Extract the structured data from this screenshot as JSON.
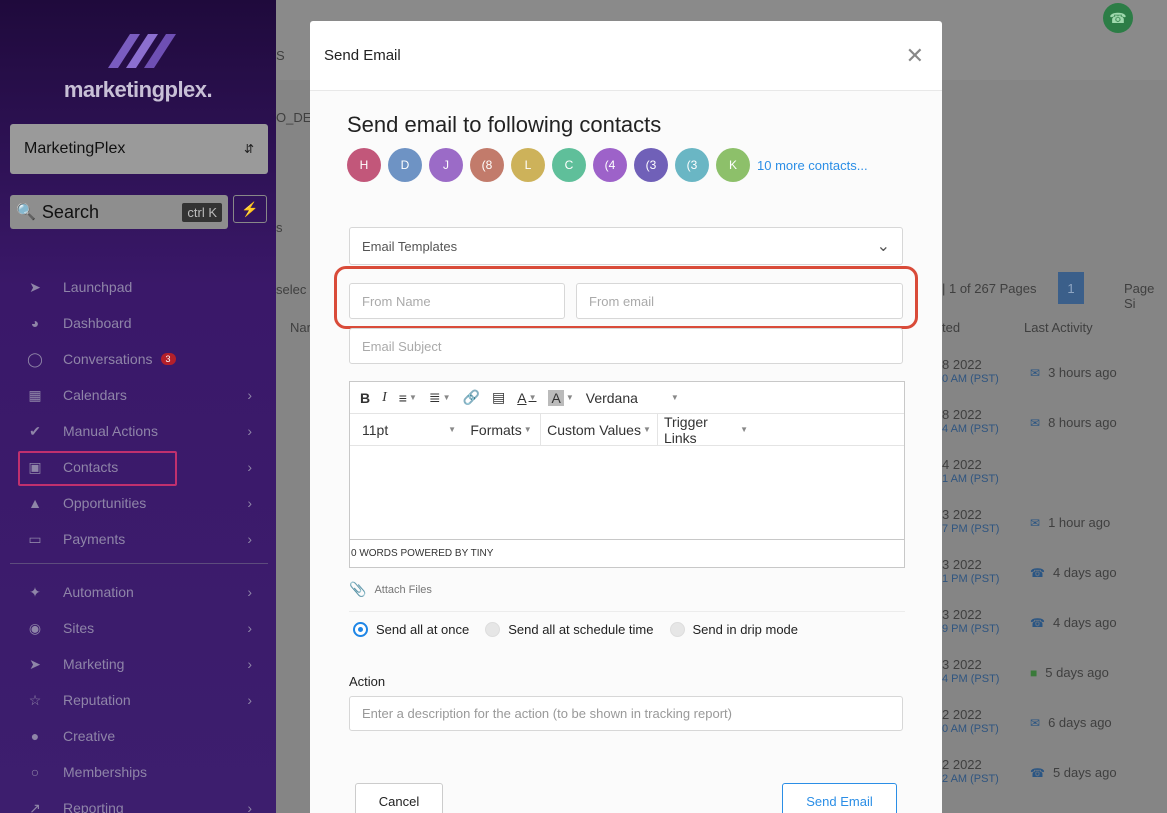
{
  "sidebar": {
    "logo": "marketingplex.",
    "account": "MarketingPlex",
    "search_label": "Search",
    "search_shortcut": "ctrl K",
    "nav_group_1": [
      {
        "label": "Launchpad",
        "icon": "rocket-icon"
      },
      {
        "label": "Dashboard",
        "icon": "speedometer-icon"
      },
      {
        "label": "Conversations",
        "icon": "chat-icon",
        "badge": "3"
      },
      {
        "label": "Calendars",
        "icon": "calendar-icon"
      },
      {
        "label": "Manual Actions",
        "icon": "check-circle-icon"
      },
      {
        "label": "Contacts",
        "icon": "contact-book-icon"
      },
      {
        "label": "Opportunities",
        "icon": "flame-icon"
      },
      {
        "label": "Payments",
        "icon": "credit-card-icon"
      }
    ],
    "nav_group_2": [
      {
        "label": "Automation",
        "icon": "magic-wand-icon"
      },
      {
        "label": "Sites",
        "icon": "globe-icon"
      },
      {
        "label": "Marketing",
        "icon": "paper-plane-icon"
      },
      {
        "label": "Reputation",
        "icon": "star-icon"
      },
      {
        "label": "Creative",
        "icon": "palette-icon"
      },
      {
        "label": "Memberships",
        "icon": "medal-icon"
      },
      {
        "label": "Reporting",
        "icon": "chart-icon"
      }
    ]
  },
  "background": {
    "top_fragment_1": "S",
    "top_fragment_2": "O_DE",
    "select_fragment": "selec",
    "name_col_fragment": "Nar",
    "s_fragment": "s",
    "pagination": "| 1 of 267 Pages",
    "page_current": "1",
    "page_size": "Page Si",
    "col_updated": "ted",
    "col_last_activity": "Last Activity",
    "rows": [
      {
        "date": "8 2022",
        "time": "0 AM (PST)",
        "activity": "3 hours ago",
        "icon": "mail-icon"
      },
      {
        "date": "8 2022",
        "time": "4 AM (PST)",
        "activity": "8 hours ago",
        "icon": "mail-icon"
      },
      {
        "date": "4 2022",
        "time": "1 AM (PST)",
        "activity": "",
        "icon": ""
      },
      {
        "date": "3 2022",
        "time": "7 PM (PST)",
        "activity": "1 hour ago",
        "icon": "mail-icon"
      },
      {
        "date": "3 2022",
        "time": "1 PM (PST)",
        "activity": "4 days ago",
        "icon": "phone-icon"
      },
      {
        "date": "3 2022",
        "time": "9 PM (PST)",
        "activity": "4 days ago",
        "icon": "phone-icon"
      },
      {
        "date": "3 2022",
        "time": "4 PM (PST)",
        "activity": "5 days ago",
        "icon": "sms-icon"
      },
      {
        "date": "2 2022",
        "time": "0 AM (PST)",
        "activity": "6 days ago",
        "icon": "mail-icon"
      },
      {
        "date": "2 2022",
        "time": "2 AM (PST)",
        "activity": "5 days ago",
        "icon": "phone-icon"
      }
    ]
  },
  "modal": {
    "title": "Send Email",
    "heading": "Send email to following contacts",
    "contacts": [
      {
        "initial": "H",
        "color": "#c2577a"
      },
      {
        "initial": "D",
        "color": "#6e93c4"
      },
      {
        "initial": "J",
        "color": "#9b6bc7"
      },
      {
        "initial": "(8",
        "color": "#c27b6b"
      },
      {
        "initial": "L",
        "color": "#cdb25a"
      },
      {
        "initial": "C",
        "color": "#5fbf9a"
      },
      {
        "initial": "(4",
        "color": "#9d62c9"
      },
      {
        "initial": "(3",
        "color": "#7060b8"
      },
      {
        "initial": "(3",
        "color": "#6ab6c4"
      },
      {
        "initial": "K",
        "color": "#8dc06a"
      }
    ],
    "more_contacts": "10 more contacts...",
    "templates_placeholder": "Email Templates",
    "from_name_placeholder": "From Name",
    "from_email_placeholder": "From email",
    "subject_placeholder": "Email Subject",
    "toolbar": {
      "font_family": "Verdana",
      "font_size": "11pt",
      "formats": "Formats",
      "custom_values": "Custom Values",
      "trigger_links": "Trigger Links"
    },
    "editor_status": "0 WORDS POWERED BY TINY",
    "attach_files": "Attach Files",
    "send_options": [
      {
        "label": "Send all at once",
        "selected": true
      },
      {
        "label": "Send all at schedule time",
        "selected": false
      },
      {
        "label": "Send in drip mode",
        "selected": false
      }
    ],
    "action_label": "Action",
    "action_placeholder": "Enter a description for the action (to be shown in tracking report)",
    "cancel_label": "Cancel",
    "send_label": "Send Email"
  },
  "colors": {
    "accent": "#2b8ee6",
    "highlight_red": "#d94b39",
    "highlight_pink": "#c0306e"
  }
}
